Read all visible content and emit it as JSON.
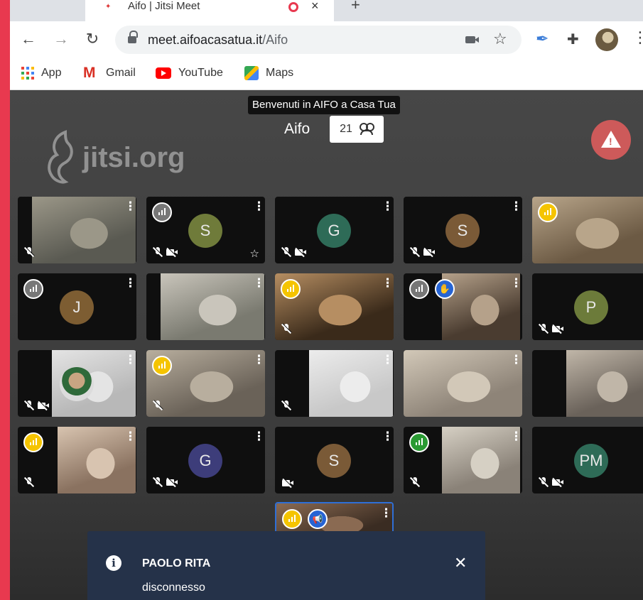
{
  "browser": {
    "tab_title": "Aifo | Jitsi Meet",
    "new_tab_label": "+",
    "url_host": "meet.aifoacasatua.it",
    "url_path": "/Aifo",
    "bookmarks": [
      {
        "label": "App",
        "icon": "apps-grid-icon"
      },
      {
        "label": "Gmail",
        "icon": "gmail-icon"
      },
      {
        "label": "YouTube",
        "icon": "youtube-icon"
      },
      {
        "label": "Maps",
        "icon": "maps-icon"
      }
    ]
  },
  "meeting": {
    "subject": "Benvenuti in AIFO a Casa Tua",
    "room_name": "Aifo",
    "participant_count": "21",
    "watermark": "jitsi.org"
  },
  "tiles": [
    {
      "avatar": "",
      "signal": "none",
      "muted": true,
      "camera_off": false
    },
    {
      "avatar": "S",
      "avatar_color": "#6f7b3a",
      "signal": "gray",
      "muted": true,
      "camera_off": true,
      "starred": true
    },
    {
      "avatar": "G",
      "avatar_color": "#2e6b57",
      "signal": "none",
      "muted": true,
      "camera_off": true
    },
    {
      "avatar": "S",
      "avatar_color": "#7a5a37",
      "signal": "none",
      "muted": true,
      "camera_off": true
    },
    {
      "avatar": "",
      "signal": "yellow",
      "muted": false,
      "camera_off": false
    },
    {
      "avatar": "J",
      "avatar_color": "#7d5d32",
      "signal": "gray",
      "muted": false,
      "camera_off": false
    },
    {
      "avatar": "",
      "signal": "none",
      "muted": false,
      "camera_off": false
    },
    {
      "avatar": "",
      "signal": "yellow",
      "muted": true,
      "camera_off": false
    },
    {
      "avatar": "",
      "signal": "gray",
      "raised_hand": true,
      "muted": false,
      "camera_off": false
    },
    {
      "avatar": "P",
      "avatar_color": "#6c7b3a",
      "signal": "none",
      "muted": true,
      "camera_off": true
    },
    {
      "avatar": "",
      "signal": "none",
      "muted": true,
      "camera_off": true
    },
    {
      "avatar": "",
      "signal": "yellow",
      "muted": true,
      "camera_off": false
    },
    {
      "avatar": "",
      "signal": "none",
      "muted": true,
      "camera_off": false
    },
    {
      "avatar": "",
      "signal": "none",
      "muted": false,
      "camera_off": false
    },
    {
      "avatar": "",
      "signal": "none",
      "muted": false,
      "camera_off": false
    },
    {
      "avatar": "",
      "signal": "yellow",
      "muted": true,
      "camera_off": false
    },
    {
      "avatar": "G",
      "avatar_color": "#3d3d7a",
      "signal": "none",
      "muted": true,
      "camera_off": true
    },
    {
      "avatar": "S",
      "avatar_color": "#7a5a37",
      "signal": "none",
      "muted": false,
      "camera_off": true
    },
    {
      "avatar": "",
      "signal": "green",
      "muted": true,
      "camera_off": false
    },
    {
      "avatar": "PM",
      "avatar_color": "#2e6b57",
      "signal": "none",
      "muted": true,
      "camera_off": true
    },
    {
      "avatar": "",
      "signal": "yellow",
      "dominant_speaker": true,
      "muted": false,
      "camera_off": false
    }
  ],
  "notification": {
    "title": "PAOLO RITA",
    "description": "disconnesso"
  },
  "colors": {
    "accent_border": "#e8394f",
    "signal_yellow": "#f5c400",
    "signal_green": "#2a9a33",
    "hand_blue": "#2664d4",
    "notification_bg": "#253249"
  }
}
